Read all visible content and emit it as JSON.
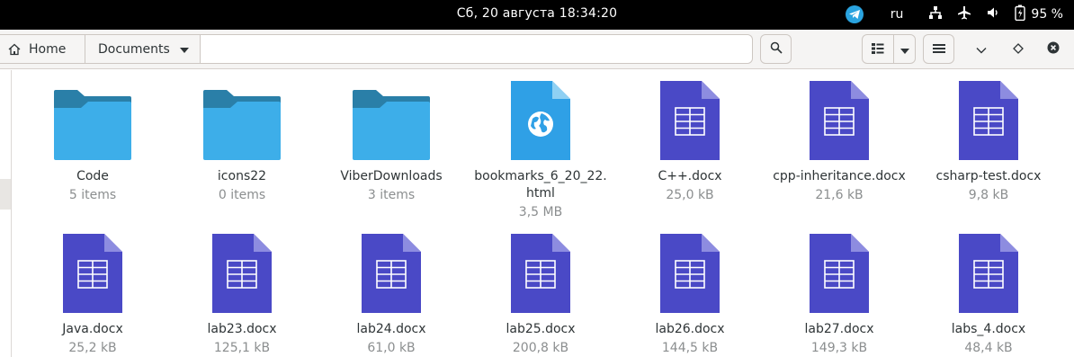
{
  "topbar": {
    "clock": "Сб, 20 августа  18:34:20",
    "lang": "ru",
    "battery_pct": "95 %",
    "icons": [
      "telegram-icon",
      "network-icon",
      "airplane-icon",
      "volume-icon",
      "battery-icon"
    ]
  },
  "header": {
    "crumbs": [
      "Home",
      "Documents"
    ],
    "icons": [
      "home-icon",
      "chevron-down-icon",
      "search-icon",
      "grid-view-icon",
      "chevron-down-icon",
      "menu-icon",
      "minimize-icon",
      "maximize-icon",
      "close-icon"
    ]
  },
  "files": [
    {
      "name": "Code",
      "meta": "5 items",
      "kind": "folder"
    },
    {
      "name": "icons22",
      "meta": "0 items",
      "kind": "folder"
    },
    {
      "name": "ViberDownloads",
      "meta": "3 items",
      "kind": "folder"
    },
    {
      "name": "bookmarks_6_20_22.\nhtml",
      "meta": "3,5 MB",
      "kind": "html"
    },
    {
      "name": "C++.docx",
      "meta": "25,0 kB",
      "kind": "docx"
    },
    {
      "name": "cpp-inheritance.docx",
      "meta": "21,6 kB",
      "kind": "docx"
    },
    {
      "name": "csharp-test.docx",
      "meta": "9,8 kB",
      "kind": "docx"
    },
    {
      "name": "Java.docx",
      "meta": "25,2 kB",
      "kind": "docx"
    },
    {
      "name": "lab23.docx",
      "meta": "125,1 kB",
      "kind": "docx"
    },
    {
      "name": "lab24.docx",
      "meta": "61,0 kB",
      "kind": "docx"
    },
    {
      "name": "lab25.docx",
      "meta": "200,8 kB",
      "kind": "docx"
    },
    {
      "name": "lab26.docx",
      "meta": "144,5 kB",
      "kind": "docx"
    },
    {
      "name": "lab27.docx",
      "meta": "149,3 kB",
      "kind": "docx"
    },
    {
      "name": "labs_4.docx",
      "meta": "48,4 kB",
      "kind": "docx"
    }
  ],
  "colors": {
    "folder_front": "#3daee9",
    "folder_back": "#2a7fa8",
    "docx": "#4a49c6",
    "docx_fold": "#8d8ce0",
    "html": "#2fa0e6"
  }
}
